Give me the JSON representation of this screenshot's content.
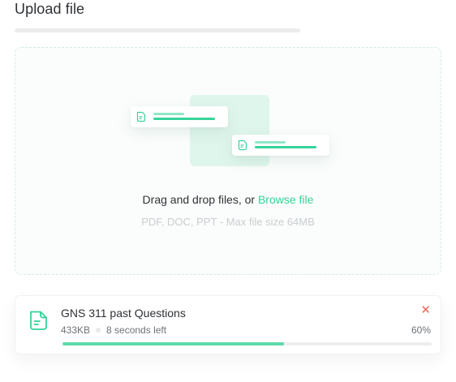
{
  "page": {
    "title": "Upload file"
  },
  "dropzone": {
    "drag_text": "Drag and drop files, or",
    "browse_label": "Browse file",
    "hint": "PDF, DOC, PPT -  Max file size 64MB"
  },
  "upload": {
    "file_name": "GNS 311 past Questions",
    "size": "433KB",
    "time_left": "8 seconds left",
    "progress_label": "60%",
    "progress_value": 0.6,
    "cancel_icon": "close-icon"
  },
  "colors": {
    "accent": "#31d497",
    "progress": "#5ed9ab",
    "cancel": "#f0675a"
  }
}
